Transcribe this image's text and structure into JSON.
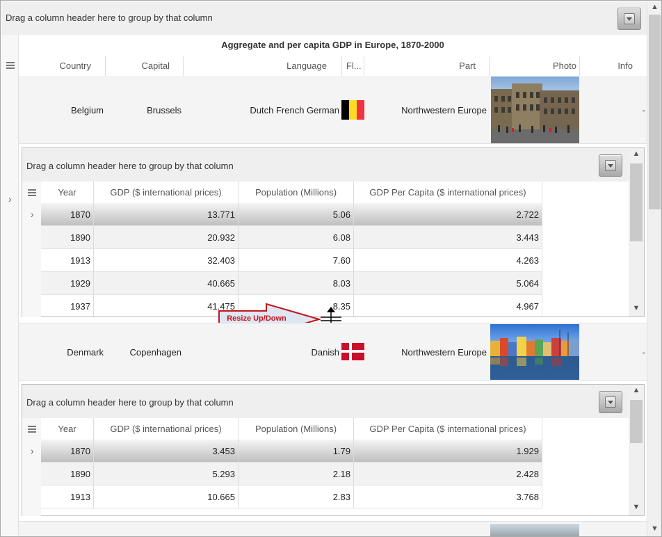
{
  "group_panel_text": "Drag a column header here to group by that column",
  "title": "Aggregate and per capita GDP in Europe, 1870-2000",
  "columns": [
    "Country",
    "Capital",
    "Language",
    "Fl...",
    "Part",
    "Photo",
    "Info"
  ],
  "rows": [
    {
      "country": "Belgium",
      "capital": "Brussels",
      "language": "Dutch French German",
      "part": "Northwestern Europe",
      "info": "-",
      "flag": "belgium-flag",
      "photo": "brussels-grand-place-photo",
      "detail": {
        "group_panel_text": "Drag a column header here to group by that column",
        "columns": [
          "Year",
          "GDP ($ international prices)",
          "Population (Millions)",
          "GDP Per Capita ($ international prices)"
        ],
        "rows": [
          [
            "1870",
            "13.771",
            "5.06",
            "2.722"
          ],
          [
            "1890",
            "20.932",
            "6.08",
            "3.443"
          ],
          [
            "1913",
            "32.403",
            "7.60",
            "4.263"
          ],
          [
            "1929",
            "40.665",
            "8.03",
            "5.064"
          ],
          [
            "1937",
            "41.475",
            "8.35",
            "4.967"
          ]
        ]
      }
    },
    {
      "country": "Denmark",
      "capital": "Copenhagen",
      "language": "Danish",
      "part": "Northwestern Europe",
      "info": "-",
      "flag": "denmark-flag",
      "photo": "copenhagen-nyhavn-photo",
      "detail": {
        "group_panel_text": "Drag a column header here to group by that column",
        "columns": [
          "Year",
          "GDP ($ international prices)",
          "Population (Millions)",
          "GDP Per Capita ($ international prices)"
        ],
        "rows": [
          [
            "1870",
            "3.453",
            "1.79",
            "1.929"
          ],
          [
            "1890",
            "5.293",
            "2.18",
            "2.428"
          ],
          [
            "1913",
            "10.665",
            "2.83",
            "3.768"
          ]
        ]
      }
    }
  ],
  "annotation": "Resize Up/Down",
  "colors": {
    "belgium_flag": [
      "#000000",
      "#FDDA24",
      "#EF3340"
    ],
    "denmark_flag": [
      "#C8102E",
      "#FFFFFF"
    ],
    "annotation_border": "#c4161c",
    "annotation_fill": "#dfe6f3"
  }
}
